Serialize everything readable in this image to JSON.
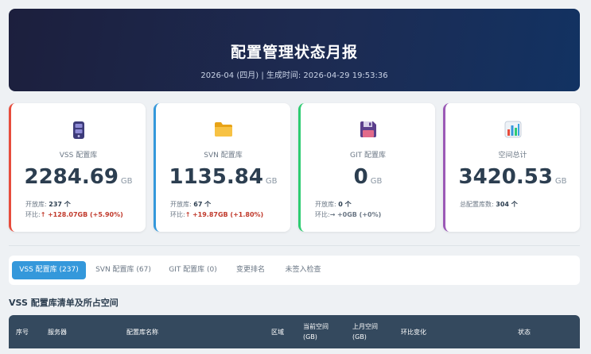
{
  "header": {
    "title": "配置管理状态月报",
    "subtitle": "2026-04 (四月) | 生成时间: 2026-04-29 19:53:36"
  },
  "cards": [
    {
      "name": "VSS 配置库",
      "value": "2284.69",
      "unit": "GB",
      "open_label": "开放库:",
      "open_value": "237 个",
      "change_label": "环比:",
      "change_arrow": "↑",
      "change_value": "+128.07GB (+5.90%)",
      "accent": "#e74c3c",
      "icon": "server-icon"
    },
    {
      "name": "SVN 配置库",
      "value": "1135.84",
      "unit": "GB",
      "open_label": "开放库:",
      "open_value": "67 个",
      "change_label": "环比:",
      "change_arrow": "↑",
      "change_value": "+19.87GB (+1.80%)",
      "accent": "#3498db",
      "icon": "folder-icon"
    },
    {
      "name": "GIT 配置库",
      "value": "0",
      "unit": "GB",
      "open_label": "开放库:",
      "open_value": "0 个",
      "change_label": "环比:",
      "change_arrow": "→",
      "change_value": "+0GB (+0%)",
      "accent": "#2ecc71",
      "icon": "floppy-disk-icon"
    },
    {
      "name": "空间总计",
      "value": "3420.53",
      "unit": "GB",
      "total_label": "总配置库数:",
      "total_value": "304 个",
      "accent": "#9b59b6",
      "icon": "bar-chart-icon"
    }
  ],
  "tabs": [
    {
      "label": "VSS 配置库 (237)",
      "active": true
    },
    {
      "label": "SVN 配置库 (67)",
      "active": false
    },
    {
      "label": "GIT 配置库 (0)",
      "active": false
    },
    {
      "label": "变更排名",
      "active": false
    },
    {
      "label": "未签入检查",
      "active": false
    }
  ],
  "section_title": "VSS 配置库清单及所占空间",
  "table": {
    "columns": [
      "序号",
      "服务器",
      "配置库名称",
      "区域",
      "当前空间\n(GB)",
      "上月空间\n(GB)",
      "环比变化",
      "状态"
    ]
  },
  "colors": {
    "header_bg_start": "#1c1f3d",
    "header_bg_end": "#123262",
    "active_tab": "#3498db",
    "table_header": "#34495e",
    "increase": "#c0392b"
  }
}
